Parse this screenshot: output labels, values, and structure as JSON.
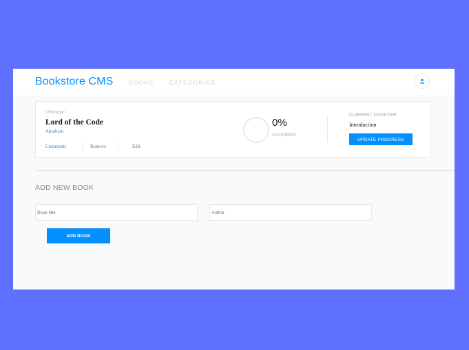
{
  "navbar": {
    "brand": "Bookstore CMS",
    "links": [
      "BOOKS",
      "CATEGORIES"
    ],
    "user_icon": "user-icon"
  },
  "book": {
    "genre": "Unknown",
    "title": "Lord of the Code",
    "author": "Abraham",
    "actions": [
      "Comments",
      "Remove",
      "Edit"
    ],
    "progress_percent": "0%",
    "progress_value": 0,
    "progress_label": "Completed",
    "chapter_label": "CURRENT CHAPTER",
    "chapter_name": "Introduction",
    "update_label": "UPDATE PROGRESS"
  },
  "form": {
    "heading": "ADD NEW BOOK",
    "title_placeholder": "Book title",
    "author_placeholder": "Author",
    "submit_label": "ADD BOOK"
  },
  "colors": {
    "page_background": "#6070fe",
    "accent": "#0290ff",
    "panel": "#fafafa"
  }
}
